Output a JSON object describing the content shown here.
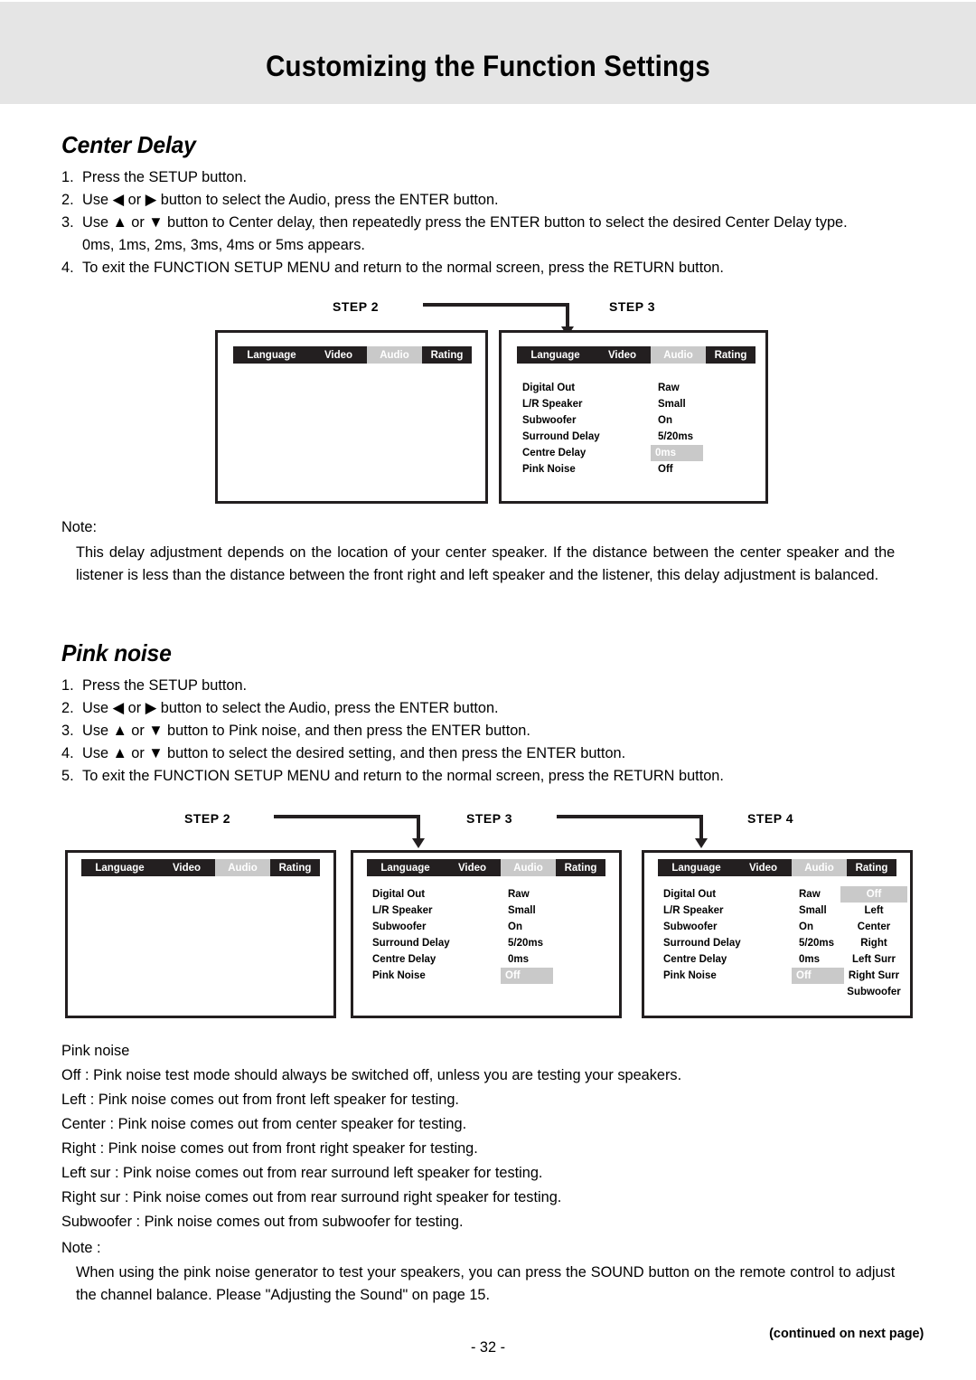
{
  "header": {
    "title": "Customizing the Function Settings"
  },
  "section_center_delay": {
    "heading": "Center Delay",
    "steps": [
      {
        "num": "1.",
        "text": "Press the SETUP button."
      },
      {
        "num": "2.",
        "text": "Use ◀ or ▶ button to select the Audio, press the ENTER button."
      },
      {
        "num": "3.",
        "text": "Use ▲ or ▼ button to Center delay, then repeatedly press the ENTER button to select the desired Center Delay type. 0ms, 1ms, 2ms, 3ms, 4ms or 5ms appears."
      },
      {
        "num": "4.",
        "text": "To exit the FUNCTION SETUP MENU and return to the normal screen, press the RETURN button."
      }
    ],
    "note_label": "Note:",
    "note_body": "This delay adjustment depends on the location of your center speaker. If the distance between the center speaker and the listener is less than the distance between the front right and left speaker and the listener, this delay adjustment is balanced."
  },
  "diagram1": {
    "labels": {
      "step2": "STEP 2",
      "step3": "STEP 3"
    },
    "menu_tabs": [
      "Language",
      "Video",
      "Audio",
      "Rating"
    ],
    "active_tab": "Audio",
    "screen_step3": {
      "rows": [
        {
          "key": "Digital Out",
          "value": "Raw",
          "highlighted": false
        },
        {
          "key": "L/R Speaker",
          "value": "Small",
          "highlighted": false
        },
        {
          "key": "Subwoofer",
          "value": "On",
          "highlighted": false
        },
        {
          "key": "Surround Delay",
          "value": "5/20ms",
          "highlighted": false
        },
        {
          "key": "Centre Delay",
          "value": "0ms",
          "highlighted": true
        },
        {
          "key": "Pink Noise",
          "value": "Off",
          "highlighted": false
        }
      ]
    }
  },
  "section_pink_noise": {
    "heading": "Pink noise",
    "steps": [
      {
        "num": "1.",
        "text": "Press the SETUP button."
      },
      {
        "num": "2.",
        "text": "Use ◀ or ▶ button to select the Audio, press the ENTER button."
      },
      {
        "num": "3.",
        "text": "Use ▲ or ▼ button to Pink noise, and then press the ENTER button."
      },
      {
        "num": "4.",
        "text": "Use ▲ or ▼ button to select the desired setting, and then press the ENTER button."
      },
      {
        "num": "5.",
        "text": "To exit the FUNCTION SETUP MENU and return to the normal screen, press the RETURN button."
      }
    ]
  },
  "diagram2": {
    "labels": {
      "step2": "STEP 2",
      "step3": "STEP 3",
      "step4": "STEP 4"
    },
    "menu_tabs": [
      "Language",
      "Video",
      "Audio",
      "Rating"
    ],
    "active_tab": "Audio",
    "screen_step3": {
      "rows": [
        {
          "key": "Digital Out",
          "value": "Raw",
          "highlighted": false
        },
        {
          "key": "L/R Speaker",
          "value": "Small",
          "highlighted": false
        },
        {
          "key": "Subwoofer",
          "value": "On",
          "highlighted": false
        },
        {
          "key": "Surround Delay",
          "value": "5/20ms",
          "highlighted": false
        },
        {
          "key": "Centre Delay",
          "value": "0ms",
          "highlighted": false
        },
        {
          "key": "Pink Noise",
          "value": "Off",
          "highlighted": true
        }
      ]
    },
    "screen_step4": {
      "rows": [
        {
          "key": "Digital Out",
          "value": "Raw",
          "highlighted": false
        },
        {
          "key": "L/R Speaker",
          "value": "Small",
          "highlighted": false
        },
        {
          "key": "Subwoofer",
          "value": "On",
          "highlighted": false
        },
        {
          "key": "Surround Delay",
          "value": "5/20ms",
          "highlighted": false
        },
        {
          "key": "Centre Delay",
          "value": "0ms",
          "highlighted": false
        },
        {
          "key": "Pink Noise",
          "value": "Off",
          "highlighted": true
        }
      ],
      "options": [
        {
          "label": "Off",
          "highlighted": true
        },
        {
          "label": "Left",
          "highlighted": false
        },
        {
          "label": "Center",
          "highlighted": false
        },
        {
          "label": "Right",
          "highlighted": false
        },
        {
          "label": "Left Surr",
          "highlighted": false
        },
        {
          "label": "Right Surr",
          "highlighted": false
        },
        {
          "label": "Subwoofer",
          "highlighted": false
        }
      ]
    }
  },
  "pink_noise_options": {
    "title": "Pink noise",
    "lines": [
      "Off :  Pink noise test mode should always be switched off, unless you are testing your speakers.",
      "Left :  Pink noise comes out from front left speaker for testing.",
      "Center :  Pink noise comes out from center speaker for testing.",
      "Right :  Pink noise comes out from front right speaker for testing.",
      "Left sur :   Pink noise comes out from rear surround left speaker for testing.",
      "Right sur :  Pink noise comes out from rear surround right speaker for testing.",
      "Subwoofer :  Pink noise comes out from subwoofer for testing."
    ]
  },
  "final_note": {
    "label": "Note :",
    "body": "When using the pink noise generator to test your speakers, you can press the SOUND button on the remote control to adjust the channel balance. Please \"Adjusting the Sound\" on page 15."
  },
  "footer": {
    "page_number": "- 32 -",
    "continued": "(continued on next page)"
  },
  "colors": {
    "header_band": "#e5e5e5",
    "osd_black": "#231f20",
    "osd_highlight": "#c9c9c9"
  }
}
